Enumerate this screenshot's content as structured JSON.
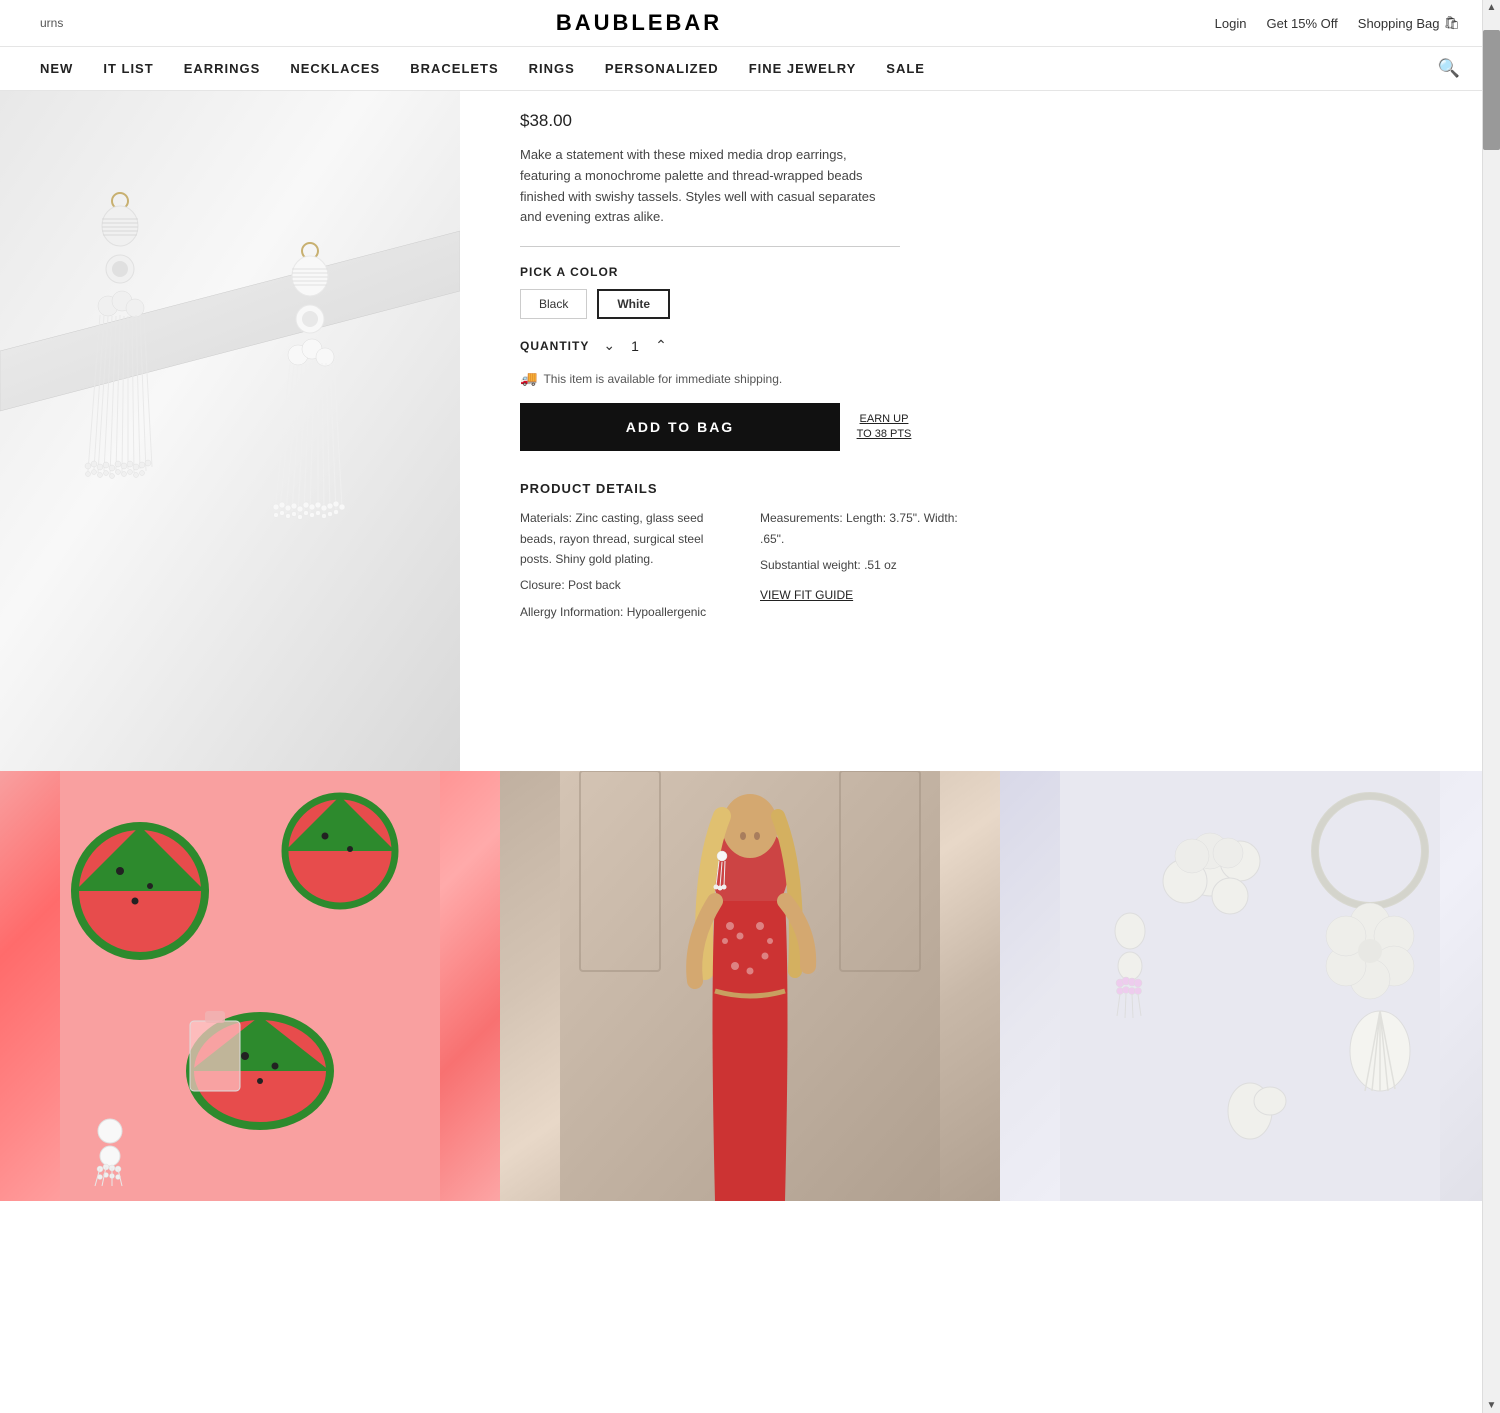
{
  "topbar": {
    "left_link": "urns",
    "logo": "BAUBLEBAR",
    "login": "Login",
    "discount": "Get 15% Off",
    "bag": "Shopping Bag",
    "bag_icon": "🛍"
  },
  "nav": {
    "items": [
      {
        "label": "NEW",
        "id": "new"
      },
      {
        "label": "IT LIST",
        "id": "it-list"
      },
      {
        "label": "EARRINGS",
        "id": "earrings"
      },
      {
        "label": "NECKLACES",
        "id": "necklaces"
      },
      {
        "label": "BRACELETS",
        "id": "bracelets"
      },
      {
        "label": "RINGS",
        "id": "rings"
      },
      {
        "label": "PERSONALIZED",
        "id": "personalized"
      },
      {
        "label": "FINE JEWELRY",
        "id": "fine-jewelry"
      },
      {
        "label": "SALE",
        "id": "sale"
      }
    ],
    "search_icon": "🔍"
  },
  "product": {
    "price": "$38.00",
    "description": "Make a statement with these mixed media drop earrings, featuring a monochrome palette and thread-wrapped beads finished with swishy tassels. Styles well with casual separates and evening extras alike.",
    "color_label": "PICK A COLOR",
    "colors": [
      {
        "label": "Black",
        "id": "black",
        "active": false
      },
      {
        "label": "White",
        "id": "white",
        "active": true
      }
    ],
    "quantity_label": "QUANTITY",
    "quantity_value": "1",
    "shipping_note": "This item is available for immediate shipping.",
    "add_to_bag_label": "ADD TO BAG",
    "earn_pts_label": "EARN UP TO 38 PTS",
    "details_title": "PRODUCT DETAILS",
    "details_left": [
      "Materials: Zinc casting, glass seed beads, rayon thread, surgical steel posts. Shiny gold plating.",
      "Closure: Post back",
      "Allergy Information: Hypoallergenic"
    ],
    "details_right": [
      "Measurements: Length: 3.75\". Width: .65\".",
      "Substantial weight: .51 oz"
    ],
    "fit_guide": "VIEW FIT GUIDE"
  }
}
